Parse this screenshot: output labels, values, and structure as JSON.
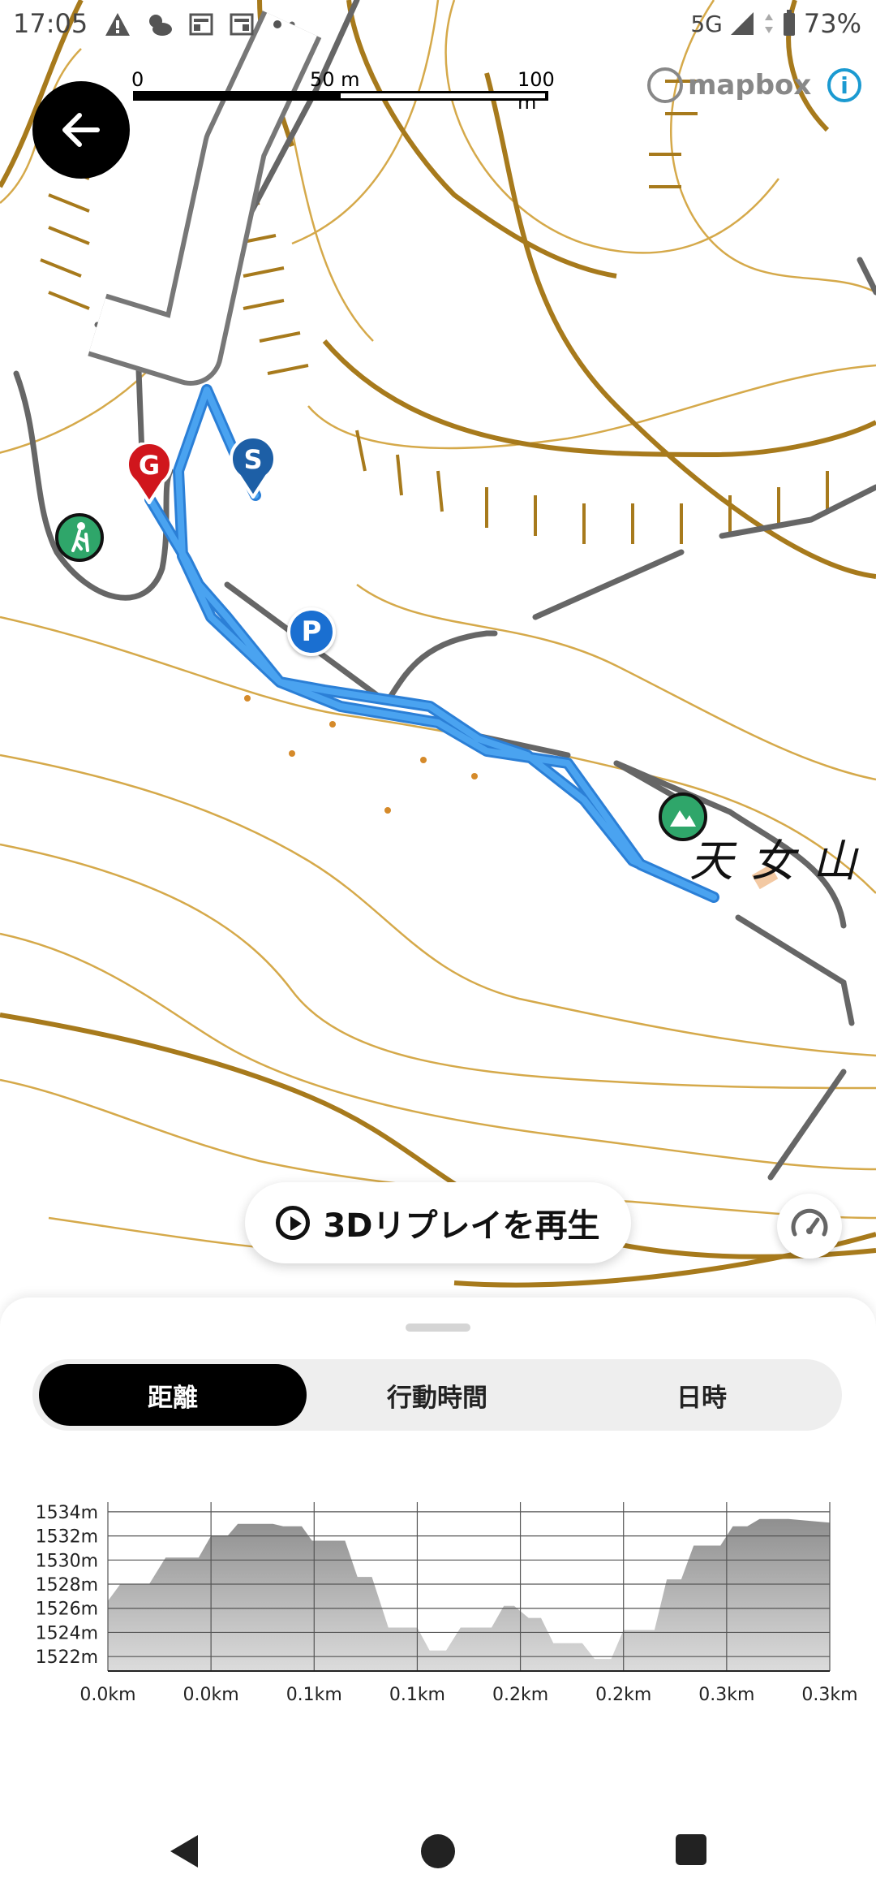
{
  "status_bar": {
    "time": "17:05",
    "network": "5G",
    "battery": "73%"
  },
  "map": {
    "scale_labels": [
      "0",
      "50 m",
      "100 m"
    ],
    "attribution": "mapbox",
    "place_label": "天女山",
    "markers": {
      "start": "S",
      "goal": "G",
      "parking": "P"
    }
  },
  "replay_button": {
    "label": "3Dリプレイを再生",
    "icon": "play-circle-icon"
  },
  "speed_button": {
    "icon": "speedometer-icon"
  },
  "tabs": [
    {
      "label": "距離",
      "active": true
    },
    {
      "label": "行動時間",
      "active": false
    },
    {
      "label": "日時",
      "active": false
    }
  ],
  "chart_data": {
    "type": "area",
    "title": "",
    "xlabel": "",
    "ylabel": "",
    "y_tick_labels": [
      "1534m",
      "1532m",
      "1530m",
      "1528m",
      "1526m",
      "1524m",
      "1522m"
    ],
    "x_tick_labels": [
      "0.0km",
      "0.0km",
      "0.1km",
      "0.1km",
      "0.2km",
      "0.2km",
      "0.3km",
      "0.3km"
    ],
    "ylim": [
      1520.8,
      1534.8
    ],
    "xlim": [
      0,
      0.35
    ],
    "grid": true,
    "series": [
      {
        "values": [
          [
            0.0,
            1526.6
          ],
          [
            0.006,
            1528.0
          ],
          [
            0.02,
            1528.0
          ],
          [
            0.028,
            1530.2
          ],
          [
            0.044,
            1530.2
          ],
          [
            0.05,
            1532.0
          ],
          [
            0.058,
            1532.0
          ],
          [
            0.063,
            1533.0
          ],
          [
            0.08,
            1533.0
          ],
          [
            0.085,
            1532.8
          ],
          [
            0.094,
            1532.8
          ],
          [
            0.099,
            1531.6
          ],
          [
            0.115,
            1531.6
          ],
          [
            0.121,
            1528.6
          ],
          [
            0.128,
            1528.6
          ],
          [
            0.136,
            1524.4
          ],
          [
            0.15,
            1524.4
          ],
          [
            0.156,
            1522.5
          ],
          [
            0.164,
            1522.5
          ],
          [
            0.171,
            1524.4
          ],
          [
            0.186,
            1524.4
          ],
          [
            0.192,
            1526.2
          ],
          [
            0.197,
            1526.2
          ],
          [
            0.204,
            1525.2
          ],
          [
            0.21,
            1525.2
          ],
          [
            0.216,
            1523.1
          ],
          [
            0.23,
            1523.1
          ],
          [
            0.236,
            1521.8
          ],
          [
            0.244,
            1521.8
          ],
          [
            0.25,
            1524.2
          ],
          [
            0.265,
            1524.2
          ],
          [
            0.271,
            1528.4
          ],
          [
            0.278,
            1528.4
          ],
          [
            0.284,
            1531.2
          ],
          [
            0.297,
            1531.2
          ],
          [
            0.303,
            1532.8
          ],
          [
            0.31,
            1532.8
          ],
          [
            0.316,
            1533.4
          ],
          [
            0.33,
            1533.4
          ],
          [
            0.35,
            1533.1
          ]
        ]
      }
    ]
  }
}
